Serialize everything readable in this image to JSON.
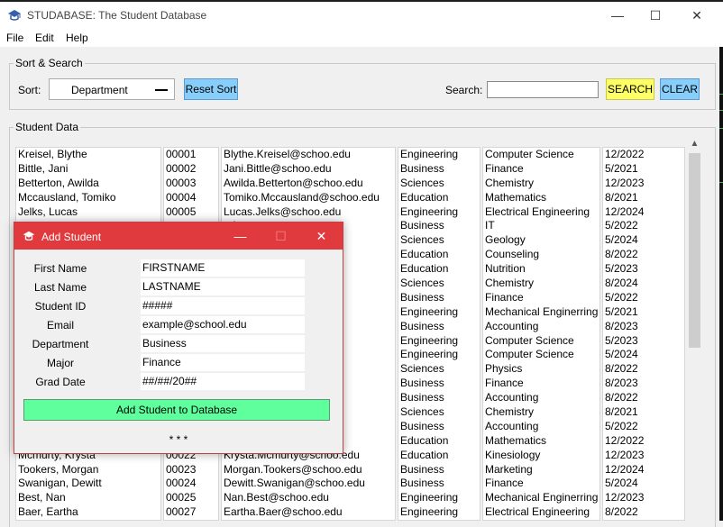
{
  "window": {
    "title": "STUDABASE: The Student Database",
    "minimize": "—",
    "maximize": "☐",
    "close": "✕"
  },
  "menu": [
    "File",
    "Edit",
    "Help"
  ],
  "sort_search": {
    "legend": "Sort & Search",
    "sort_label": "Sort:",
    "sort_value": "Department",
    "reset_button": "Reset Sort",
    "search_label": "Search:",
    "search_value": "",
    "search_button": "SEARCH",
    "clear_button": "CLEAR"
  },
  "student_data": {
    "legend": "Student Data",
    "rows": [
      [
        "Kreisel, Blythe",
        "00001",
        "Blythe.Kreisel@schoo.edu",
        "Engineering",
        "Computer Science",
        "12/2022"
      ],
      [
        "Bittle, Jani",
        "00002",
        "Jani.Bittle@schoo.edu",
        "Business",
        "Finance",
        "5/2021"
      ],
      [
        "Betterton, Awilda",
        "00003",
        "Awilda.Betterton@schoo.edu",
        "Sciences",
        "Chemistry",
        "12/2023"
      ],
      [
        "Mccausland, Tomiko",
        "00004",
        "Tomiko.Mccausland@schoo.edu",
        "Education",
        "Mathematics",
        "8/2021"
      ],
      [
        "Jelks, Lucas",
        "00005",
        "Lucas.Jelks@schoo.edu",
        "Engineering",
        "Electrical Engineering",
        "12/2024"
      ],
      [
        "",
        "",
        "edu",
        "Business",
        "IT",
        "5/2022"
      ],
      [
        "",
        "",
        "u",
        "Sciences",
        "Geology",
        "5/2024"
      ],
      [
        "",
        "",
        "",
        "Education",
        "Counseling",
        "8/2022"
      ],
      [
        "",
        "",
        "o.edu",
        "Education",
        "Nutrition",
        "5/2023"
      ],
      [
        "",
        "",
        "",
        "Sciences",
        "Chemistry",
        "8/2024"
      ],
      [
        "",
        "",
        "u",
        "Business",
        "Finance",
        "5/2022"
      ],
      [
        "",
        "",
        "u",
        "Engineering",
        "Mechanical Enginerring",
        "5/2021"
      ],
      [
        "",
        "",
        ".edu",
        "Business",
        "Accounting",
        "8/2023"
      ],
      [
        "",
        "",
        "du",
        "Engineering",
        "Computer Science",
        "5/2023"
      ],
      [
        "",
        "",
        "u",
        "Engineering",
        "Computer Science",
        "5/2024"
      ],
      [
        "",
        "",
        "edu",
        "Sciences",
        "Physics",
        "8/2022"
      ],
      [
        "",
        "",
        "",
        "Business",
        "Finance",
        "8/2023"
      ],
      [
        "",
        "",
        "du",
        "Business",
        "Accounting",
        "8/2022"
      ],
      [
        "",
        "",
        "du",
        "Sciences",
        "Chemistry",
        "8/2021"
      ],
      [
        "",
        "",
        "du",
        "Business",
        "Accounting",
        "5/2022"
      ],
      [
        "",
        "",
        "edu",
        "Education",
        "Mathematics",
        "12/2022"
      ],
      [
        "Mcmurty, Krysta",
        "00022",
        "Krysta.Mcmurty@schoo.edu",
        "Education",
        "Kinesiology",
        "12/2023"
      ],
      [
        "Tookers, Morgan",
        "00023",
        "Morgan.Tookers@schoo.edu",
        "Business",
        "Marketing",
        "12/2024"
      ],
      [
        "Swanigan, Dewitt",
        "00024",
        "Dewitt.Swanigan@schoo.edu",
        "Business",
        "Finance",
        "5/2024"
      ],
      [
        "Best, Nan",
        "00025",
        "Nan.Best@schoo.edu",
        "Engineering",
        "Mechanical Enginerring",
        "12/2023"
      ],
      [
        "Baer, Eartha",
        "00027",
        "Eartha.Baer@schoo.edu",
        "Engineering",
        "Electrical Engineering",
        "8/2022"
      ]
    ]
  },
  "dialog": {
    "title": "Add Student",
    "minimize": "—",
    "maximize": "☐",
    "close": "✕",
    "fields": [
      {
        "label": "First Name",
        "value": "FIRSTNAME"
      },
      {
        "label": "Last Name",
        "value": "LASTNAME"
      },
      {
        "label": "Student ID",
        "value": "#####"
      },
      {
        "label": "Email",
        "value": "example@school.edu"
      },
      {
        "label": "Department",
        "value": "Business"
      },
      {
        "label": "Major",
        "value": "Finance"
      },
      {
        "label": "Grad Date",
        "value": "##/##/20##"
      }
    ],
    "add_button": "Add Student to Database",
    "status": "* * *"
  },
  "colors": {
    "dialog_titlebar": "#e13a3e",
    "reset_clear_buttons": "#87cefa",
    "search_button": "#ffff66",
    "add_button": "#5eff9c"
  },
  "icons": {
    "app": "graduation-cap-icon",
    "dialog": "graduation-cap-icon"
  }
}
